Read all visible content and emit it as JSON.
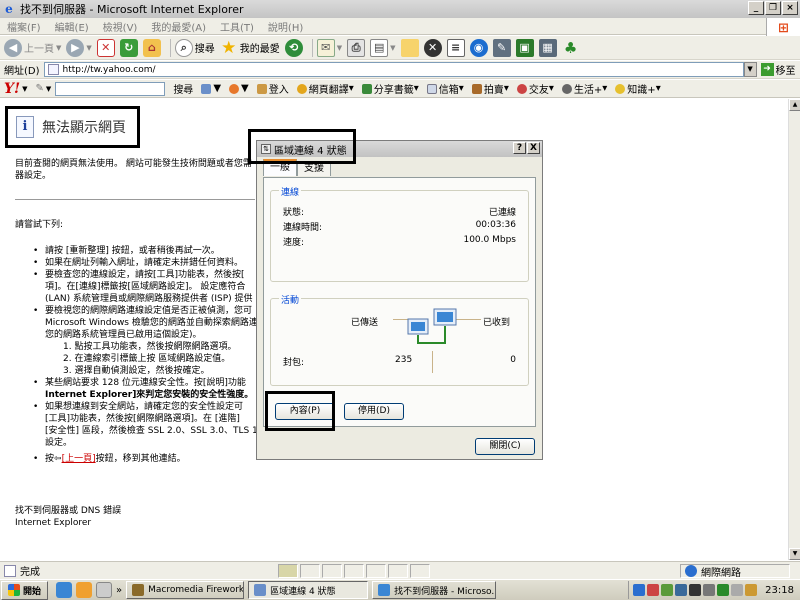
{
  "window": {
    "title": "找不到伺服器 - Microsoft Internet Explorer"
  },
  "menu": [
    "檔案(F)",
    "編輯(E)",
    "檢視(V)",
    "我的最愛(A)",
    "工具(T)",
    "說明(H)"
  ],
  "toolbar": {
    "back": "上一頁",
    "search": "搜尋",
    "favorites": "我的最愛"
  },
  "address": {
    "label": "網址(D)",
    "url": "http://tw.yahoo.com/",
    "go": "移至"
  },
  "yahoo": {
    "logo": "Y!",
    "search_btn": "搜尋",
    "login": "登入",
    "items": [
      "網頁翻譯",
      "分享書籤",
      "信箱",
      "拍賣",
      "交友",
      "生活+",
      "知識+"
    ]
  },
  "page": {
    "error_title": "無法顯示網頁",
    "desc1": "目前查閱的網頁無法使用。 網站可能發生技術問題或者您需",
    "desc2": "器設定。",
    "try_heading": "請嘗試下列:",
    "bullets": [
      "請按 [重新整理] 按鈕，或者稍後再試一次。",
      "如果在網址列輸入網址，請確定未拼錯任何資料。",
      "要檢查您的連線設定，請按[工具]功能表，然後按[",
      "項]。在[連線]標籤按[區域網路設定]。 設定應符合",
      "(LAN) 系統管理員或網際網路服務提供者 (ISP) 提供",
      "要檢視您的網際網路連線設定值是否正被偵測，您可",
      "Microsoft Windows 檢驗您的網路並自動探索網路連線",
      "您的網路系統管理員已啟用這個設定)。"
    ],
    "steps": [
      "1.   點按工具功能表，然後按網際網路選項。",
      "2.   在連線索引標籤上按 區域網路設定值。",
      "3.   選擇自動偵測設定，然後按確定。"
    ],
    "bullets2": [
      "某些網站要求 128 位元連線安全性。按[說明]功能",
      "Internet Explorer]來判定您安裝的安全性強度。",
      "如果想連線到安全網站，請確定您的安全性設定可",
      "[工具]功能表，然後按[網際網路選項]。在 [進階]",
      "[安全性] 區段，然後檢查 SSL 2.0、SSL 3.0、TLS 1.0",
      "設定。"
    ],
    "back_prefix": "按",
    "back_link": "[上一頁]",
    "back_suffix": "按鈕，移到其他連結。",
    "footer1": "找不到伺服器或 DNS 錯誤",
    "footer2": "Internet Explorer"
  },
  "dialog": {
    "title": "區域連線 4 狀態",
    "help": "?",
    "close": "X",
    "tabs": [
      "一般",
      "支援"
    ],
    "connection": {
      "label": "連線",
      "status_label": "狀態:",
      "status": "已連線",
      "duration_label": "連線時間:",
      "duration": "00:03:36",
      "speed_label": "速度:",
      "speed": "100.0 Mbps"
    },
    "activity": {
      "label": "活動",
      "sent": "已傳送",
      "received": "已收到",
      "packets_label": "封包:",
      "sent_packets": "235",
      "received_packets": "0"
    },
    "properties_btn": "內容(P)",
    "disable_btn": "停用(D)",
    "close_btn": "關閉(C)"
  },
  "statusbar": {
    "text": "完成",
    "zone": "網際網路"
  },
  "taskbar": {
    "start": "開始",
    "tasks": [
      "Macromedia Fireworks M...",
      "區域連線 4 狀態",
      "找不到伺服器 - Microso..."
    ],
    "clock": "23:18"
  },
  "colors": {
    "xp_blue": "#0046d5",
    "link_red": "#cc0000",
    "title_bar": "#c4c4c4"
  }
}
